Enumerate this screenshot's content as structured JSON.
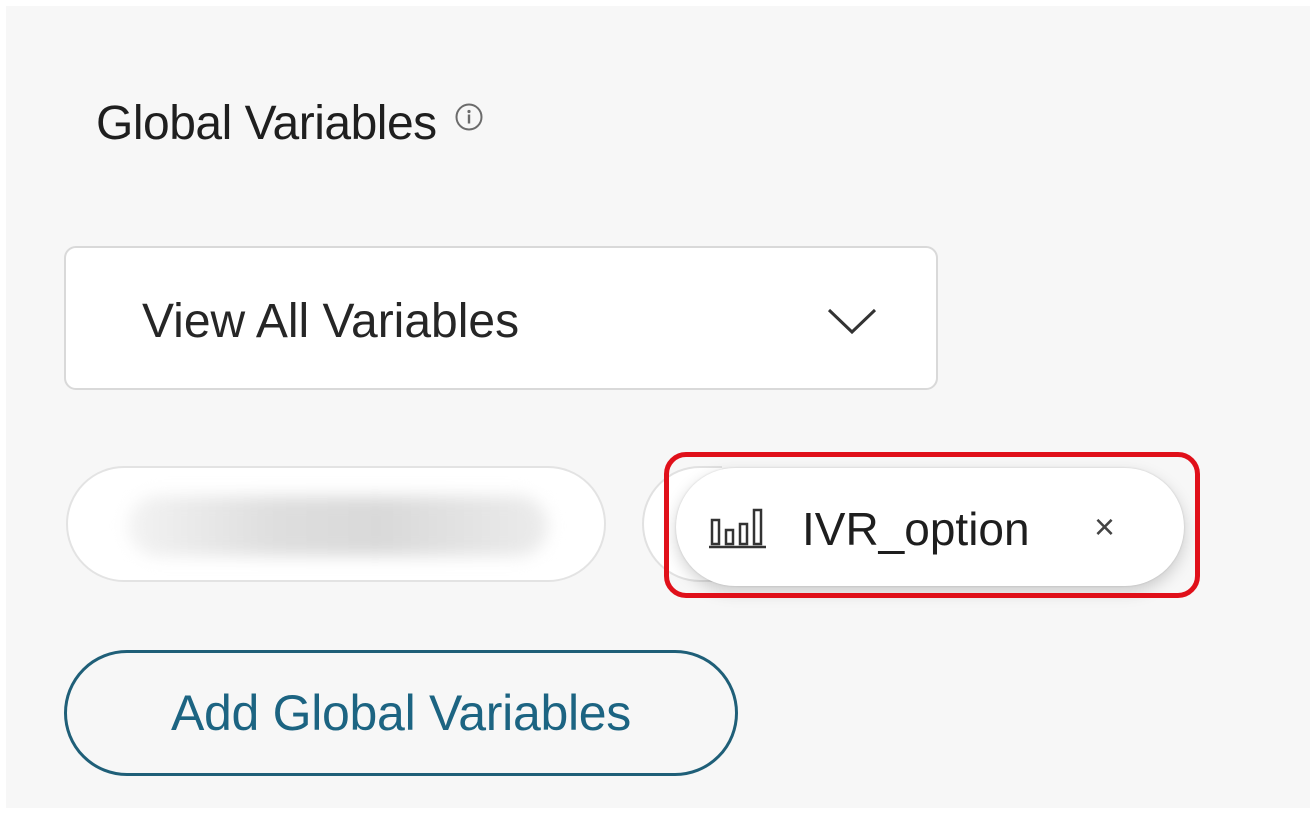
{
  "section": {
    "title": "Global Variables",
    "info_icon": "info-circle-icon"
  },
  "dropdown": {
    "selected": "View All Variables",
    "icon": "chevron-down-icon"
  },
  "chips": [
    {
      "label": "IVR_option",
      "icon": "bar-chart-icon",
      "close": "×",
      "highlighted": true
    }
  ],
  "add_button": {
    "label": "Add Global Variables"
  },
  "colors": {
    "panel_bg": "#f7f7f7",
    "accent": "#1c6482",
    "highlight": "#e0101a"
  }
}
